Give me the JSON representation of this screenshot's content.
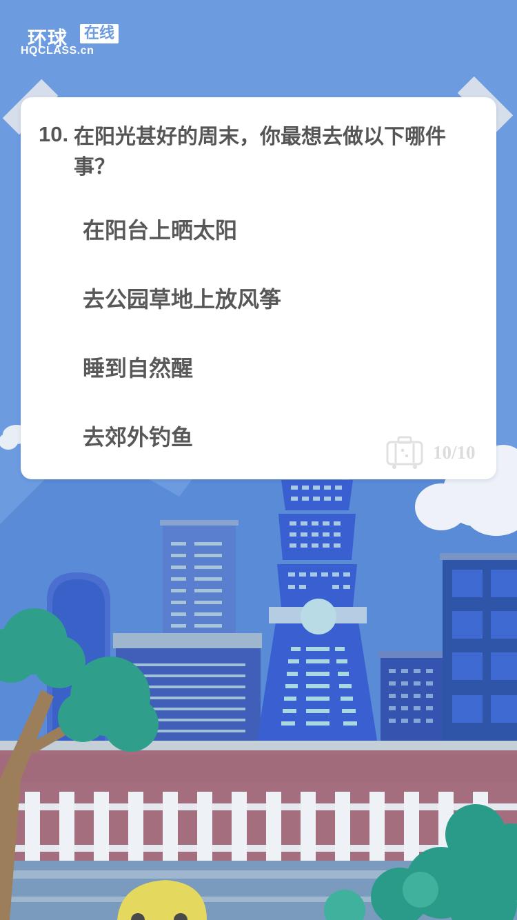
{
  "logo": {
    "name_cn": "环球",
    "box_text": "在线",
    "domain": "HQCLASS.cn"
  },
  "question": {
    "number": "10.",
    "text": "在阳光甚好的周末，你最想去做以下哪件事？"
  },
  "options": [
    "在阳台上晒太阳",
    "去公园草地上放风筝",
    "睡到自然醒",
    "去郊外钓鱼"
  ],
  "progress": {
    "label": "10/10",
    "current": 10,
    "total": 10
  },
  "icons": {
    "progress_icon": "suitcase-icon"
  },
  "colors": {
    "sky": "#6c9be0",
    "card": "#ffffff",
    "text": "#555555",
    "counter": "#dcdcdc"
  }
}
